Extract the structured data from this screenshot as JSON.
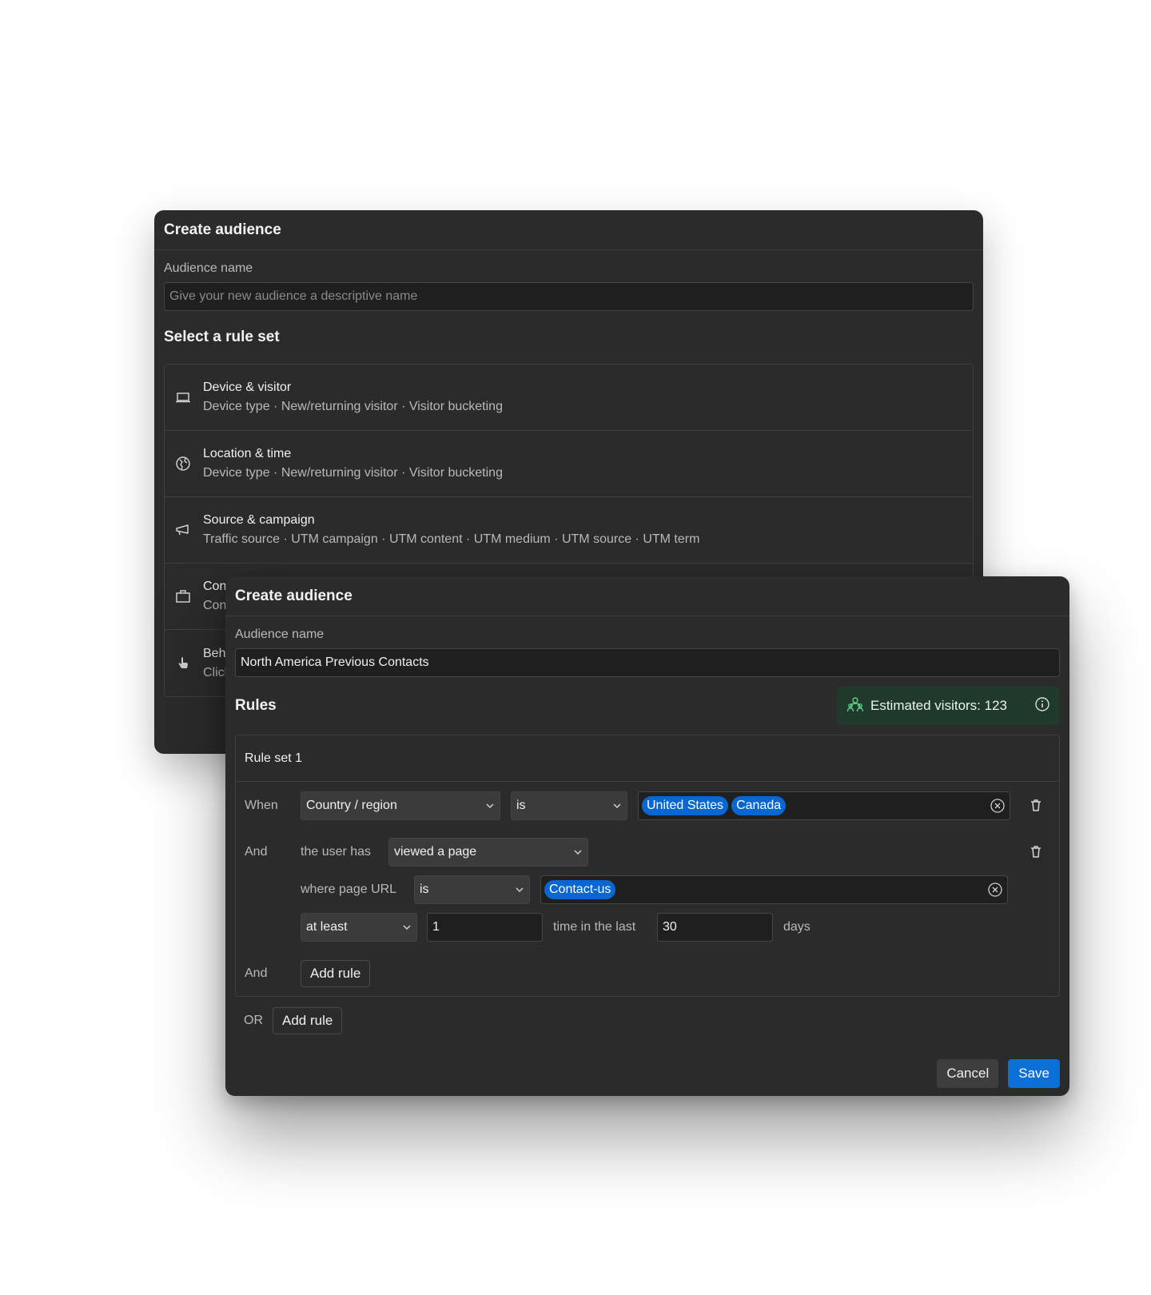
{
  "back_dialog": {
    "title": "Create audience",
    "name_label": "Audience name",
    "name_placeholder": "Give your new audience a descriptive name",
    "section_title": "Select a rule set",
    "rule_sets": [
      {
        "name": "Device & visitor",
        "desc": "Device type · New/returning visitor · Visitor bucketing",
        "icon": "laptop-icon"
      },
      {
        "name": "Location & time",
        "desc": "Device type · New/returning visitor · Visitor bucketing",
        "icon": "globe-icon"
      },
      {
        "name": "Source & campaign",
        "desc": "Traffic source · UTM campaign · UTM content · UTM medium · UTM source · UTM term",
        "icon": "megaphone-icon"
      },
      {
        "name": "Con",
        "desc": "Con",
        "icon": "briefcase-icon"
      },
      {
        "name": "Beh",
        "desc": "Clicl",
        "icon": "pointer-hand-icon"
      }
    ]
  },
  "front_dialog": {
    "title": "Create audience",
    "name_label": "Audience name",
    "name_value": "North America Previous Contacts",
    "rules_title": "Rules",
    "estimate": {
      "text": "Estimated visitors: 123",
      "bg": "#1f3a2a",
      "icon": "users-icon"
    },
    "rule_set": {
      "title": "Rule set 1",
      "when_label": "When",
      "condition1": {
        "field": "Country / region",
        "operator": "is",
        "values": [
          "United States",
          "Canada"
        ]
      },
      "and_label": "And",
      "condition2": {
        "prefix": "the user has",
        "action": "viewed a page",
        "url_label": "where page URL",
        "url_operator": "is",
        "url_values": [
          "Contact-us"
        ],
        "frequency": "at least",
        "count": "1",
        "time_label": "time in the last",
        "days": "30",
        "days_label": "days"
      },
      "and_label_2": "And",
      "add_rule": "Add rule"
    },
    "or_label": "OR",
    "or_add_rule": "Add rule",
    "cancel": "Cancel",
    "save": "Save",
    "accent": "#0a6fd6"
  }
}
